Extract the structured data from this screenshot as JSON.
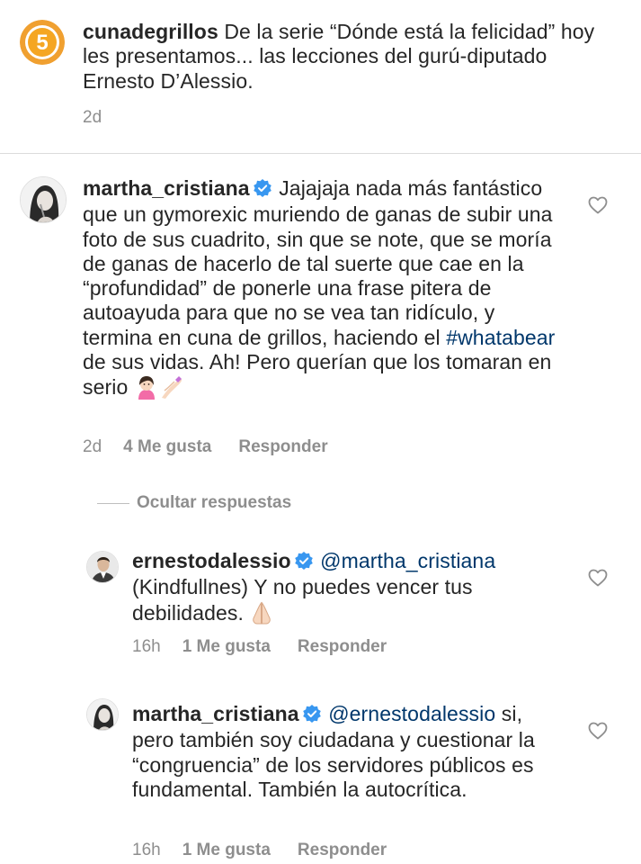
{
  "comments": [
    {
      "username": "cunadegrillos",
      "text": "De la serie “Dónde está la felicidad” hoy les presentamos... las lecciones del gurú-diputado Ernesto D’Alessio.",
      "time": "2d",
      "avatar_label": "5"
    },
    {
      "username": "martha_cristiana",
      "verified": true,
      "text_before": "Jajajaja nada más fantástico que un gymorexic muriendo de ganas de subir una foto de sus cuadrito, sin que se note, que se moría de ganas de hacerlo de tal suerte que cae en la “profundidad” de ponerle una frase pitera de autoayuda para que no se vea tan ridículo, y termina en cuna de grillos, haciendo el",
      "hashtag": "#whatabear",
      "text_after": "de sus vidas. Ah! Pero querían que los tomaran en serio",
      "time": "2d",
      "likes": "4 Me gusta",
      "reply": "Responder",
      "like_icon": "heart-outline-icon"
    }
  ],
  "hide_replies": "Ocultar respuestas",
  "replies": [
    {
      "username": "ernestodalessio",
      "verified": true,
      "mention": "@martha_cristiana",
      "text": "(Kindfullnes) Y no puedes vencer tus debilidades.",
      "time": "16h",
      "likes": "1 Me gusta",
      "reply": "Responder"
    },
    {
      "username": "martha_cristiana",
      "verified": true,
      "mention": "@ernestodalessio",
      "text": "si, pero también soy ciudadana y cuestionar la “congruencia” de los servidores públicos es fundamental. También la autocrítica.",
      "time": "16h",
      "likes": "1 Me gusta",
      "reply": "Responder"
    }
  ],
  "colors": {
    "text": "#262626",
    "meta": "#8e8e8e",
    "link": "#00376b",
    "verified": "#3897f0",
    "badge_orange": "#f5a623"
  }
}
